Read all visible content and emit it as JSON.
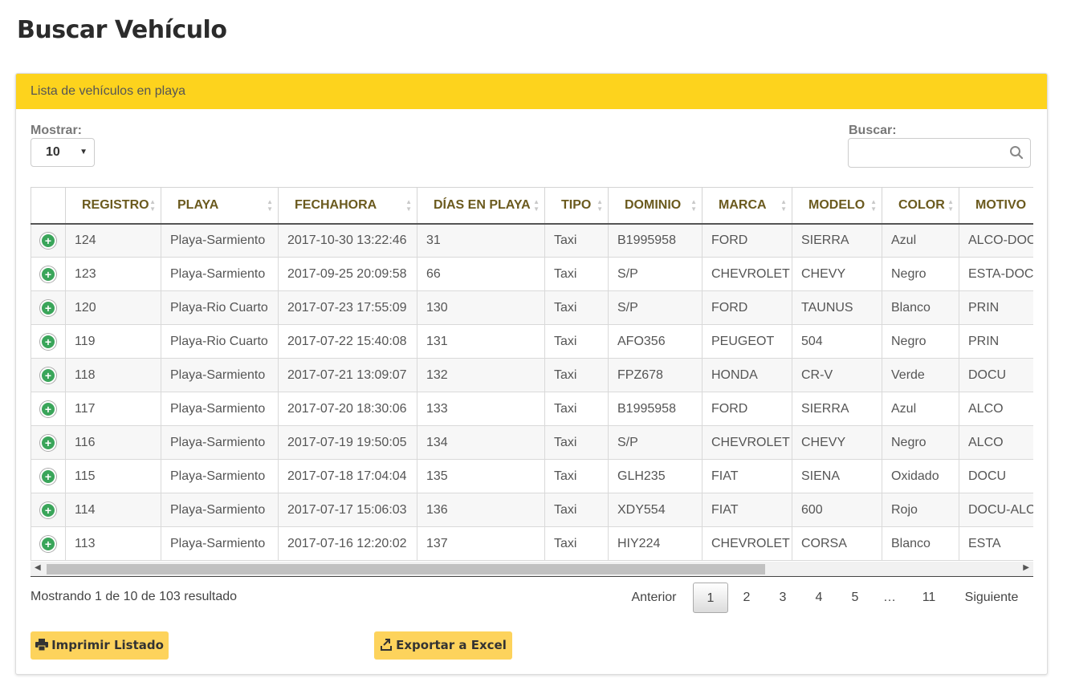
{
  "page": {
    "title": "Buscar Vehículo"
  },
  "panel": {
    "heading": "Lista de vehículos en playa"
  },
  "controls": {
    "show_label": "Mostrar:",
    "show_value": "10",
    "search_label": "Buscar:",
    "search_value": "",
    "search_placeholder": ""
  },
  "table": {
    "columns": [
      "",
      "REGISTRO",
      "PLAYA",
      "FECHAHORA",
      "DÍAS EN PLAYA",
      "TIPO",
      "DOMINIO",
      "MARCA",
      "MODELO",
      "COLOR",
      "MOTIVO"
    ],
    "rows": [
      [
        "124",
        "Playa-Sarmiento",
        "2017-10-30 13:22:46",
        "31",
        "Taxi",
        "B1995958",
        "FORD",
        "SIERRA",
        "Azul",
        "ALCO-DOCU"
      ],
      [
        "123",
        "Playa-Sarmiento",
        "2017-09-25 20:09:58",
        "66",
        "Taxi",
        "S/P",
        "CHEVROLET",
        "CHEVY",
        "Negro",
        "ESTA-DOCU"
      ],
      [
        "120",
        "Playa-Rio Cuarto",
        "2017-07-23 17:55:09",
        "130",
        "Taxi",
        "S/P",
        "FORD",
        "TAUNUS",
        "Blanco",
        "PRIN"
      ],
      [
        "119",
        "Playa-Rio Cuarto",
        "2017-07-22 15:40:08",
        "131",
        "Taxi",
        "AFO356",
        "PEUGEOT",
        "504",
        "Negro",
        "PRIN"
      ],
      [
        "118",
        "Playa-Sarmiento",
        "2017-07-21 13:09:07",
        "132",
        "Taxi",
        "FPZ678",
        "HONDA",
        "CR-V",
        "Verde",
        "DOCU"
      ],
      [
        "117",
        "Playa-Sarmiento",
        "2017-07-20 18:30:06",
        "133",
        "Taxi",
        "B1995958",
        "FORD",
        "SIERRA",
        "Azul",
        "ALCO"
      ],
      [
        "116",
        "Playa-Sarmiento",
        "2017-07-19 19:50:05",
        "134",
        "Taxi",
        "S/P",
        "CHEVROLET",
        "CHEVY",
        "Negro",
        "ALCO"
      ],
      [
        "115",
        "Playa-Sarmiento",
        "2017-07-18 17:04:04",
        "135",
        "Taxi",
        "GLH235",
        "FIAT",
        "SIENA",
        "Oxidado",
        "DOCU"
      ],
      [
        "114",
        "Playa-Sarmiento",
        "2017-07-17 15:06:03",
        "136",
        "Taxi",
        "XDY554",
        "FIAT",
        "600",
        "Rojo",
        "DOCU-ALCO"
      ],
      [
        "113",
        "Playa-Sarmiento",
        "2017-07-16 12:20:02",
        "137",
        "Taxi",
        "HIY224",
        "CHEVROLET",
        "CORSA",
        "Blanco",
        "ESTA"
      ]
    ]
  },
  "footer": {
    "info": "Mostrando 1 de 10 de 103 resultado",
    "pagination": {
      "prev": "Anterior",
      "pages": [
        "1",
        "2",
        "3",
        "4",
        "5",
        "…",
        "11"
      ],
      "current": "1",
      "next": "Siguiente"
    }
  },
  "buttons": {
    "print": "Imprimir Listado",
    "export": "Exportar a Excel"
  },
  "colors": {
    "heading_bg": "#fdd31d",
    "button_bg": "#fdd35c",
    "expand_icon": "#3aa55a"
  }
}
